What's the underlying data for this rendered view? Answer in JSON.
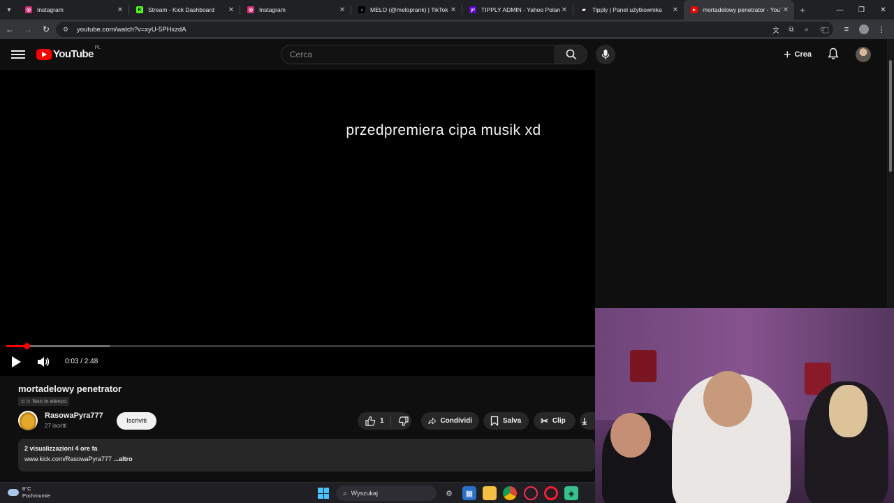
{
  "browser": {
    "tabs": [
      {
        "title": "Instagram",
        "favicon_color": "#d62976",
        "active": false
      },
      {
        "title": "Stream - Kick Dashboard",
        "favicon_color": "#53fc18",
        "active": false
      },
      {
        "title": "Instagram",
        "favicon_color": "#d62976",
        "active": false
      },
      {
        "title": "MELO (@meloprank) | TikTok",
        "favicon_color": "#000000",
        "active": false
      },
      {
        "title": "TIPPLY ADMIN - Yahoo Poland",
        "favicon_color": "#6001d2",
        "active": false
      },
      {
        "title": "Tipply | Panel użytkownika",
        "favicon_color": "#1e1e1e",
        "active": false
      },
      {
        "title": "mortadelowy penetrator - YouT",
        "favicon_color": "#ff0000",
        "active": true
      }
    ],
    "url": "youtube.com/watch?v=xyU-5PHxzdA"
  },
  "youtube": {
    "logo_text": "YouTube",
    "country_code": "PL",
    "search_placeholder": "Cerca",
    "create_label": "Crea"
  },
  "player": {
    "overlay_text": "przedpremiera cipa musik xd",
    "time_current": "0:03",
    "time_total": "2:48",
    "time_display": "0:03 / 2:48",
    "played_fraction": 0.034,
    "buffered_fraction": 0.175
  },
  "video": {
    "title": "mortadelowy penetrator",
    "visibility": "Non in elenco",
    "channel_name": "RasowaPyra777",
    "subscribers": "27 iscritti",
    "subscribe_label": "Iscriviti",
    "likes": "1",
    "share_label": "Condividi",
    "save_label": "Salva",
    "clip_label": "Clip",
    "views_and_date": "2 visualizzazioni  4 ore fa",
    "description_link": "www.kick.com/RasowaPyra777",
    "more_label": "...altro"
  },
  "taskbar": {
    "temperature": "8°C",
    "weather": "Pochmurnie",
    "search_label": "Wyszukaj"
  },
  "colors": {
    "yt_red": "#ff0000",
    "background": "#0f0f0f",
    "chip": "#272727"
  }
}
